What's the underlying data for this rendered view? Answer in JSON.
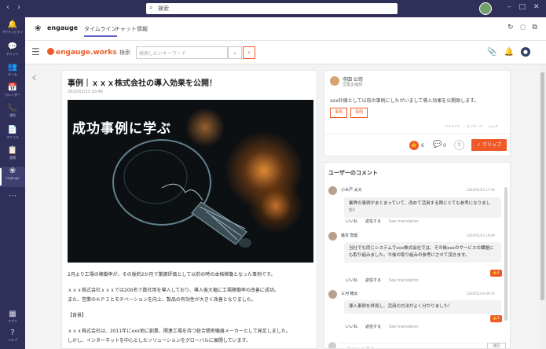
{
  "teams": {
    "search_placeholder": "検索",
    "rail": [
      {
        "icon": "bell-icon",
        "glyph": "🔔",
        "label": "アクティビティ"
      },
      {
        "icon": "chat-icon",
        "glyph": "💬",
        "label": "チャット"
      },
      {
        "icon": "teams-icon",
        "glyph": "👥",
        "label": "チーム"
      },
      {
        "icon": "calendar-icon",
        "glyph": "📅",
        "label": "カレンダー"
      },
      {
        "icon": "phone-icon",
        "glyph": "📞",
        "label": "通話"
      },
      {
        "icon": "files-icon",
        "glyph": "📄",
        "label": "ファイル"
      },
      {
        "icon": "assignments-icon",
        "glyph": "📋",
        "label": "課題"
      },
      {
        "icon": "engauge-app-icon",
        "glyph": "❀",
        "label": "engauge"
      },
      {
        "icon": "more-icon",
        "glyph": "⋯",
        "label": ""
      },
      {
        "icon": "apps-icon",
        "glyph": "▦",
        "label": "アプリ"
      },
      {
        "icon": "help-icon",
        "glyph": "?",
        "label": "ヘルプ"
      }
    ]
  },
  "app_header": {
    "app_name": "engauge",
    "tabs": [
      {
        "label": "タイムライン",
        "active": true
      },
      {
        "label": "チャット",
        "active": false
      },
      {
        "label": "情報",
        "active": false
      }
    ]
  },
  "engauge_bar": {
    "brand": "engauge.works",
    "search_label": "検索",
    "search_placeholder": "検索したいキーワード"
  },
  "article": {
    "title": "事例｜ｘｘｘ株式会社の導入効果を公開！",
    "date": "2020/01/23 10:48",
    "hero_text": "成功事例に学ぶ",
    "body": [
      "2月より工場の稼働率が、その後約2か月で業績評価として以前の時の本格稼働となった事例です。",
      "",
      "ｘｘｘ株式会社ｘｘｘでは200名で数社用を導入しており、導入後大幅に工場稼働率の改善に成功。",
      "また、営業のＫＰＩとモチベーションを向上、製品の有効性が大きく改善となりました。",
      "",
      "【背景】",
      "",
      "ｘｘｘ株式会社は、2011年にxxx地に創業、関連工場を持つ総合精密機器メーカーとして発足しました。",
      "しかし、インターネットを中心としたソリューションをグローバルに展開しています。"
    ]
  },
  "detail": {
    "author": "寺田 公司",
    "department": "営業企画部",
    "description": "xxx社様として以前の事例にしたがいまして導入効果を公開致します。",
    "tags": [
      "事例",
      "事例"
    ],
    "meta": [
      "ハイライト",
      "エンゲージ",
      "シェア"
    ],
    "like_count": "6",
    "comment_count": "0",
    "clip_label": "✓ クリップ"
  },
  "comments": {
    "heading": "ユーザーのコメント",
    "items": [
      {
        "name": "小木戸 太大",
        "date": "2020/01/23 17:34",
        "text": "業界の事例がまとまっていて、改めて活用する際にとても参考になりました！",
        "likes": ""
      },
      {
        "name": "森本 智起",
        "date": "2020/01/23 18:09",
        "text": "当社でも同じシステムでxxx株式会社では、その後xxxのサービスの課題にも取り組みました。今後の取り組みの参考にさせて頂きます。",
        "likes": "2"
      },
      {
        "name": "三河 穂太",
        "date": "2020/01/24 09:10",
        "text": "導入事例を拝見し、活用の方法がよく分かりました！",
        "likes": "1"
      }
    ],
    "action_like": "いいね",
    "action_reply": "返信する",
    "action_translate": "See translation",
    "input_placeholder": "コメントする",
    "send_label": "送信"
  },
  "colors": {
    "teams_purple": "#2f2f5a",
    "engauge_orange": "#f05a28"
  }
}
